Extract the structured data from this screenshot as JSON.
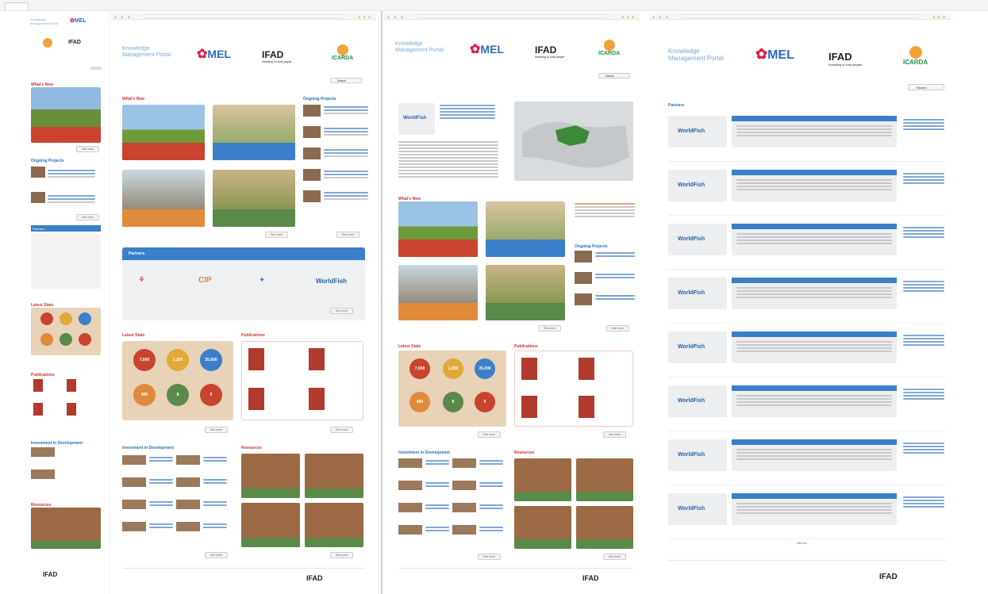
{
  "brand": {
    "portal_title": "Knowledge Management Portal",
    "mel": "MEL",
    "ifad": "IFAD",
    "ifad_tagline": "Investing in rural people",
    "icarda": "ICARDA",
    "worldfish": "WorldFish",
    "cip": "CIP"
  },
  "sections": {
    "whats_new": "What's New",
    "ongoing_projects": "Ongoing Projects",
    "partners": "Partners",
    "latest_stats": "Latest Stats",
    "publications": "Publications",
    "innovations": "Investment in Development",
    "resources": "Resources"
  },
  "search_label": "Search",
  "more_label": "See more",
  "see_all_label": "See All",
  "stats": [
    "7,000",
    "1,200",
    "35,000",
    "400",
    "8",
    "5"
  ],
  "worldfish_row_count": 8,
  "colors": {
    "red": "#c9432f",
    "blue": "#3b7fc9",
    "orange": "#e08a3c",
    "green": "#5a8a4a",
    "tan": "#e8d2b8",
    "accent": "#2a6ebb"
  }
}
